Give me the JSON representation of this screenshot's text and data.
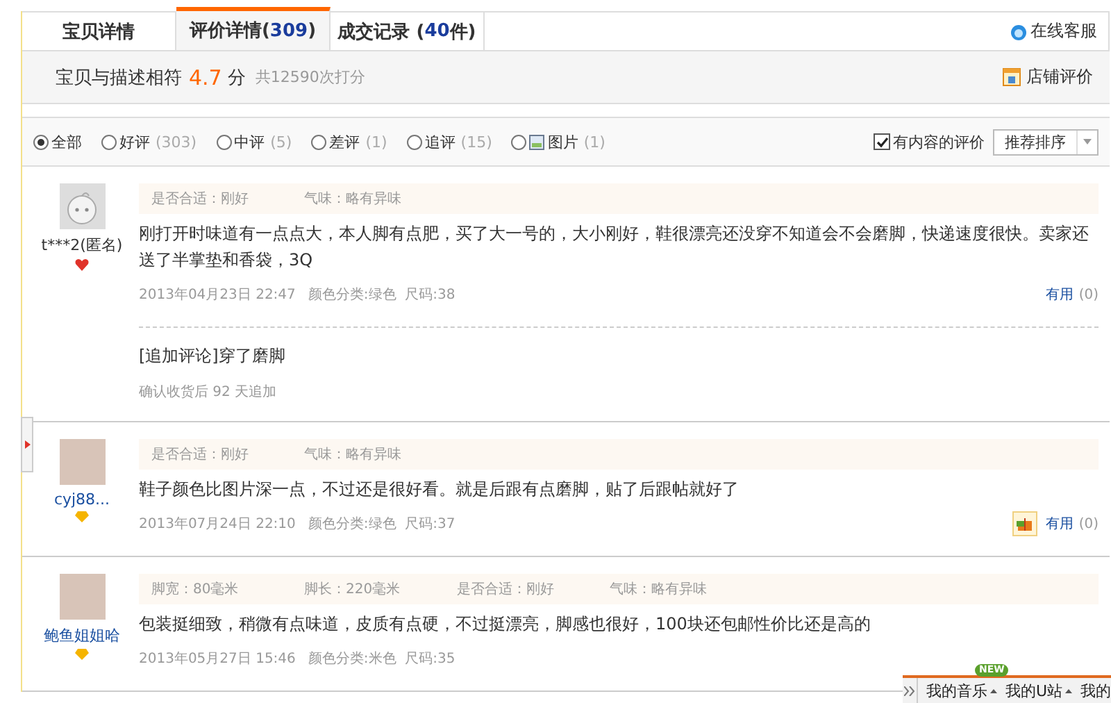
{
  "tabs": [
    {
      "parts": [
        {
          "kind": "plain",
          "text": "宝贝详情"
        }
      ],
      "selected": false
    },
    {
      "parts": [
        {
          "kind": "plain",
          "text": "评价详情("
        },
        {
          "kind": "count",
          "text": "309"
        },
        {
          "kind": "plain",
          "text": ")"
        }
      ],
      "selected": true
    },
    {
      "parts": [
        {
          "kind": "plain",
          "text": "成交记录 ("
        },
        {
          "kind": "count",
          "text": "40"
        },
        {
          "kind": "plain",
          "text": "件)"
        }
      ],
      "selected": false
    }
  ],
  "service_link": "在线客服",
  "score": {
    "label": "宝贝与描述相符",
    "value": "4.7",
    "unit": "分",
    "total": "共12590次打分",
    "shop_link": "店铺评价"
  },
  "filters": [
    {
      "kind": "text",
      "label": "全部",
      "selected": true
    },
    {
      "kind": "text",
      "label": "好评",
      "count": "(303)",
      "selected": false
    },
    {
      "kind": "text",
      "label": "中评",
      "count": "(5)",
      "selected": false
    },
    {
      "kind": "text",
      "label": "差评",
      "count": "(1)",
      "selected": false
    },
    {
      "kind": "text",
      "label": "追评",
      "count": "(15)",
      "selected": false
    },
    {
      "kind": "image",
      "label": "图片",
      "count": "(1)",
      "selected": false
    }
  ],
  "content_only": {
    "label": "有内容的评价",
    "checked": true
  },
  "sort": {
    "value": "推荐排序"
  },
  "reviews": [
    {
      "avatar": {
        "kind": "cartoon"
      },
      "user": "t***2(匿名)",
      "anonymous": true,
      "badge": {
        "kind": "heart"
      },
      "attributes": [
        "是否合适：刚好",
        "气味：略有异味"
      ],
      "content": "刚打开时味道有一点点大，本人脚有点肥，买了大一号的，大小刚好，鞋很漂亮还没穿不知道会不会磨脚，快递速度很快。卖家还送了半掌垫和香袋，3Q",
      "date": "2013年04月23日 22:47",
      "spec": "颜色分类:绿色  尺码:38",
      "gift": false,
      "useful": "有用",
      "useful_count": "(0)",
      "followup": {
        "text": "[追加评论]穿了磨脚",
        "note": "确认收货后 92 天追加"
      }
    },
    {
      "avatar": {
        "kind": "photo"
      },
      "user": "cyj88...",
      "anonymous": false,
      "badge": {
        "kind": "diamond"
      },
      "attributes": [
        "是否合适：刚好",
        "气味：略有异味"
      ],
      "content": "鞋子颜色比图片深一点，不过还是很好看。就是后跟有点磨脚，贴了后跟帖就好了",
      "date": "2013年07月24日 22:10",
      "spec": "颜色分类:绿色  尺码:37",
      "gift": true,
      "useful": "有用",
      "useful_count": "(0)"
    },
    {
      "avatar": {
        "kind": "photo"
      },
      "user": "鲍鱼姐姐哈",
      "anonymous": false,
      "badge": {
        "kind": "diamond"
      },
      "attributes": [
        "脚宽：80毫米",
        "脚长：220毫米",
        "是否合适：刚好",
        "气味：略有异味"
      ],
      "content": "包装挺细致，稍微有点味道，皮质有点硬，不过挺漂亮，脚感也很好，100块还包邮性价比还是高的",
      "date": "2013年05月27日 15:46",
      "spec": "颜色分类:米色  尺码:35",
      "gift": false
    }
  ],
  "toolbar": {
    "badge": "NEW",
    "items": [
      {
        "label": "我的音乐"
      },
      {
        "label": "我的U站"
      },
      {
        "label": "我的"
      }
    ]
  }
}
